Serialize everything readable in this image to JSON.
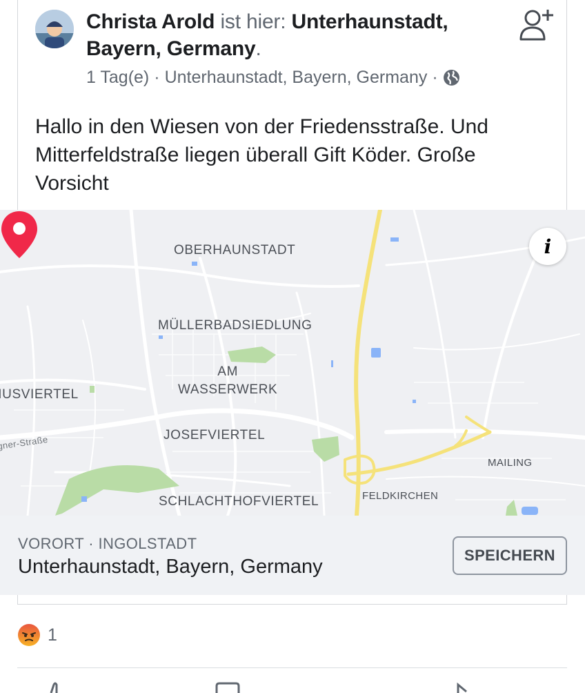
{
  "post": {
    "author": "Christa Arold",
    "verb": "ist hier:",
    "place_line1": "Unterhaunstadt,",
    "place_line2": "Bayern, Germany",
    "place_suffix": ".",
    "time": "1 Tag(e)",
    "separator": "·",
    "location": "Unterhaunstadt, Bayern, Germany",
    "privacy_icon": "globe-icon",
    "text": "Hallo in den Wiesen von der Friedensstraße. Und Mitterfeldstraße liegen überall Gift Köder. Große Vorsicht"
  },
  "map": {
    "labels": {
      "oberhaunstadt": "OBERHAUNSTADT",
      "muellerbad": "MÜLLERBADSIEDLUNG",
      "am_wasserwerk_1": "AM",
      "am_wasserwerk_2": "WASSERWERK",
      "piusviertel": "PIUSVIERTEL",
      "josefviertel": "JOSEFVIERTEL",
      "schlachthof": "SCHLACHTHOFVIERTEL",
      "feldkirchen": "FELDKIRCHEN",
      "mailing": "MAILING",
      "street": "gner-Straße"
    },
    "info_icon": "info-icon",
    "pin_icon": "map-pin-icon",
    "colors": {
      "pin": "#f02849",
      "highway": "#f5e27a",
      "park": "#b9dca6",
      "water": "#8ab4f8"
    }
  },
  "place": {
    "category": "VORORT · INGOLSTADT",
    "name": "Unterhaunstadt, Bayern, Germany",
    "save_label": "SPEICHERN"
  },
  "reactions": {
    "icon": "angry-reaction-icon",
    "count": "1"
  }
}
